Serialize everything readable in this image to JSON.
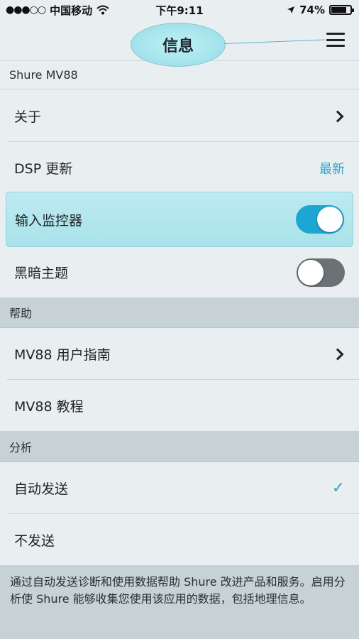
{
  "status_bar": {
    "signal": "●●●○○",
    "carrier": "中国移动",
    "time": "下午9:11",
    "battery_text": "74%",
    "battery_level": 0.74
  },
  "nav": {
    "title": "信息"
  },
  "device_section": {
    "label": "Shure MV88"
  },
  "rows": {
    "about": {
      "label": "关于"
    },
    "dsp_update": {
      "label": "DSP 更新",
      "value": "最新"
    },
    "input_monitor": {
      "label": "输入监控器",
      "toggle_on": true
    },
    "dark_theme": {
      "label": "黑暗主题",
      "toggle_on": false
    }
  },
  "help_section": {
    "header": "帮助",
    "user_guide": "MV88 用户指南",
    "tutorial": "MV88 教程"
  },
  "analytics_section": {
    "header": "分析",
    "auto_send": "自动发送",
    "no_send": "不发送"
  },
  "footer": {
    "note": "通过自动发送诊断和使用数据帮助 Shure 改进产品和服务。启用分析使 Shure 能够收集您使用该应用的数据，包括地理信息。"
  },
  "colors": {
    "accent": "#2fa8cf",
    "toggle_on": "#1ea6d3",
    "toggle_off": "#6b7276",
    "section_bg": "#c7d2d7",
    "highlight_bg": "#a9e2ea"
  }
}
